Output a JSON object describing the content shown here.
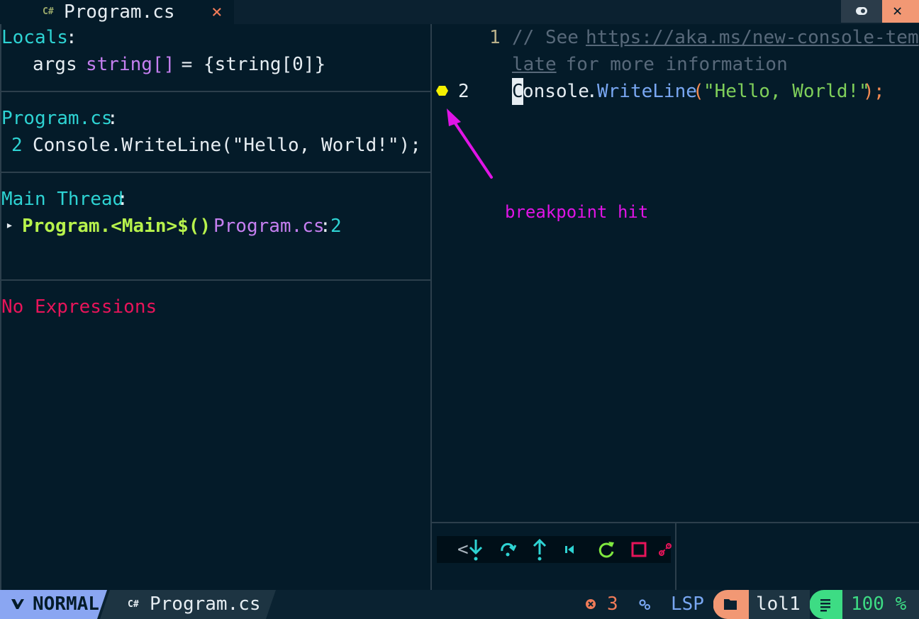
{
  "tab": {
    "lang_icon": "C#",
    "title": "Program.cs",
    "close": "×"
  },
  "top_buttons": {
    "toggle_icon": "toggle-icon",
    "close": "✕"
  },
  "locals": {
    "header": "Locals",
    "colon": ":",
    "var_name": "args",
    "var_type": "string[]",
    "var_value": " = {string[0]}"
  },
  "breakpoints": {
    "header": "Program.cs",
    "colon": ":",
    "line_no": "2",
    "code": "Console.WriteLine(\"Hello, World!\");"
  },
  "threads": {
    "header": "Main Thread",
    "colon": ":",
    "expander": "▸",
    "frame_name": "Program.<Main>$()",
    "frame_file": "Program.cs",
    "frame_sep": ":",
    "frame_line": "2"
  },
  "watches": {
    "empty": "No Expressions"
  },
  "editor": {
    "line1_no": "1",
    "line1_comment_pre": "// See ",
    "line1_url_a": "https://aka.ms/new-console-temp",
    "line1_url_b": "late",
    "line1_comment_post": " for more information",
    "line2_no": "2",
    "line2_cursor": "C",
    "line2_obj": "onsole",
    "line2_dot": ".",
    "line2_method": "WriteLine",
    "line2_paren_open": "(",
    "line2_string": "\"Hello, World!\"",
    "line2_paren_close": ")",
    "line2_semi": ";"
  },
  "annotation": {
    "label": "breakpoint hit"
  },
  "dap_controls": {
    "prefix": "<",
    "icons": [
      "step-into-icon",
      "step-over-icon",
      "step-out-icon",
      "step-back-icon",
      "restart-icon",
      "stop-icon",
      "disconnect-icon"
    ]
  },
  "statusline": {
    "mode": "NORMAL",
    "file_icon": "C#",
    "file": "Program.cs",
    "error_count": "3",
    "lsp": "LSP",
    "folder": "lol1",
    "progress": "100 %"
  },
  "colors": {
    "background": "#041b29",
    "accent_cyan": "#2ed3d3",
    "accent_violet": "#c57ff0",
    "accent_lime": "#b7f24c",
    "error_red": "#e8145a",
    "annotation_magenta": "#e014e6",
    "breakpoint_yellow": "#f5f000",
    "mode_blue": "#8aa6f2",
    "status_orange": "#f29874",
    "status_green": "#3ddc84"
  }
}
